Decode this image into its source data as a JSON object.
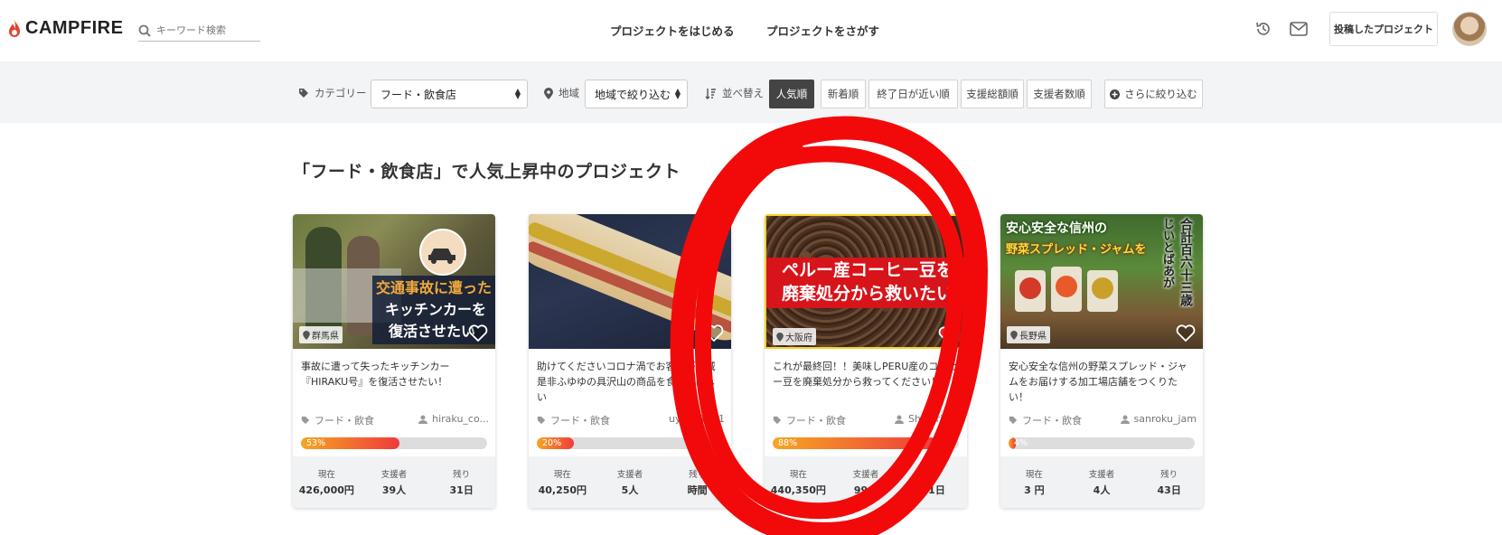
{
  "header": {
    "brand": "CAMPFIRE",
    "search_placeholder": "キーワード検索",
    "nav": [
      "プロジェクトをはじめる",
      "プロジェクトをさがす"
    ],
    "posted_projects": "投稿したプロジェクト"
  },
  "filters": {
    "category_label": "カテゴリー",
    "category_value": "フード・飲食店",
    "region_label": "地域",
    "region_value": "地域で絞り込む",
    "sort_label": "並べ替え",
    "sort_options": [
      "人気順",
      "新着順",
      "終了日が近い順",
      "支援総額順",
      "支援者数順"
    ],
    "sort_active": "人気順",
    "more_filter": "さらに絞り込む"
  },
  "section_title": "「フード・飲食店」で人気上昇中のプロジェクト",
  "stat_labels": {
    "current": "現在",
    "backers": "支援者",
    "remaining": "残り"
  },
  "cards": [
    {
      "prefecture": "群馬県",
      "thumb_text": [
        "交通事故に遭った",
        "キッチンカーを",
        "復活させたい"
      ],
      "title": "事故に遭って失ったキッチンカー『HIRAKU号』を復活させたい！",
      "category": "フード・飲食",
      "owner": "hiraku_co...",
      "progress": 53,
      "progress_label": "53%",
      "current": "426,000円",
      "backers": "39人",
      "remaining": "31日",
      "favorited": false
    },
    {
      "prefecture": "",
      "thumb_text": [],
      "title": "助けてくださいコロナ渦でお客様が激減是非ふゆゆの具沢山の商品を食べてほしい",
      "category": "フード・飲食",
      "owner": "uyuyu1111",
      "progress": 20,
      "progress_label": "20%",
      "current": "40,250円",
      "backers": "5人",
      "remaining": "時間",
      "favorited": false
    },
    {
      "prefecture": "大阪府",
      "thumb_text": [
        "ペルー産コーヒー豆を",
        "廃棄処分から救いたい"
      ],
      "title": "これが最終回！！美味しPERU産のコーヒー豆を廃棄処分から救ってください！",
      "category": "フード・飲食",
      "owner": "Shinorinco",
      "progress": 88,
      "progress_label": "88%",
      "current": "440,350円",
      "backers": "99人",
      "remaining": "31日",
      "favorited": true
    },
    {
      "prefecture": "長野県",
      "thumb_text": [
        "安心安全な信州の",
        "野菜スプレッド・ジャムを",
        "合計百六十三歳",
        "じいとばあが"
      ],
      "title": "安心安全な信州の野菜スプレッド・ジャムをお届けする加工場店舗をつくりたい！",
      "category": "フード・飲食",
      "owner": "sanroku_jam",
      "progress": 4,
      "progress_label": "4%",
      "current": "3 円",
      "backers": "4人",
      "remaining": "43日",
      "favorited": false
    }
  ],
  "colors": {
    "accent": "#ef3b3b",
    "brand_flame": "#e8402e",
    "active_sort": "#444444"
  }
}
